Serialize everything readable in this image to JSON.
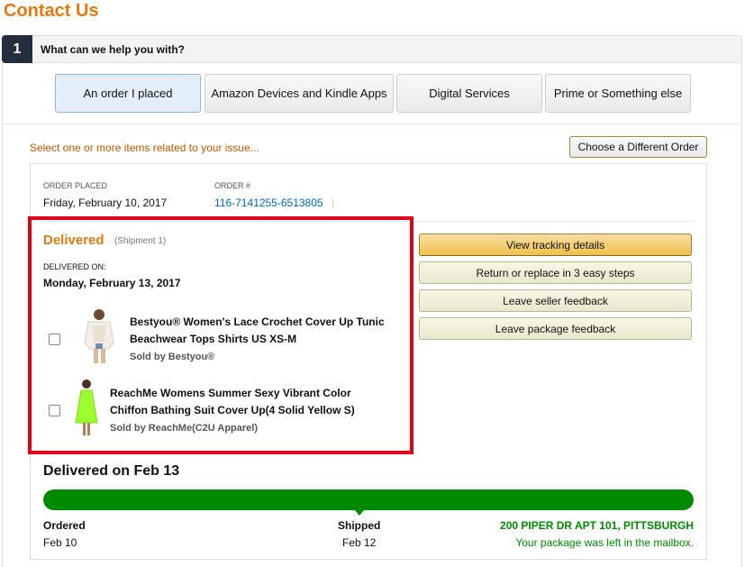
{
  "page_title": "Contact Us",
  "step": {
    "number": "1",
    "label": "What can we help you with?"
  },
  "categories": [
    {
      "label": "An order I placed",
      "selected": true
    },
    {
      "label": "Amazon Devices and Kindle Apps",
      "selected": false
    },
    {
      "label": "Digital Services",
      "selected": false
    },
    {
      "label": "Prime or Something else",
      "selected": false
    }
  ],
  "select_message": "Select one or more items related to your issue...",
  "choose_order_button": "Choose a Different Order",
  "order": {
    "placed_label": "ORDER PLACED",
    "placed_value": "Friday, February 10, 2017",
    "number_label": "ORDER #",
    "number_value": "116-7141255-6513805",
    "pipe": "|"
  },
  "shipment": {
    "status": "Delivered",
    "shipment_label": "(Shipment 1)",
    "delivered_on_label": "DELIVERED ON:",
    "delivered_on_value": "Monday, February 13, 2017",
    "items": [
      {
        "title_line1": "Bestyou® Women's Lace Crochet Cover Up Tunic",
        "title_line2": "Beachwear Tops Shirts US XS-M",
        "seller": "Sold by Bestyou®"
      },
      {
        "title_line1": "ReachMe Womens Summer Sexy Vibrant Color",
        "title_line2": "Chiffon Bathing Suit Cover Up(4 Solid Yellow S)",
        "seller": "Sold by ReachMe(C2U Apparel)"
      }
    ]
  },
  "actions": {
    "tracking": "View tracking details",
    "return": "Return or replace in 3 easy steps",
    "seller_feedback": "Leave seller feedback",
    "package_feedback": "Leave package feedback"
  },
  "tracking": {
    "headline": "Delivered on Feb 13",
    "progress_fraction": 1.0,
    "ordered_label": "Ordered",
    "ordered_date": "Feb 10",
    "shipped_label": "Shipped",
    "shipped_date": "Feb 12",
    "address": "200 PIPER DR APT 101, PITTSBURGH",
    "note": "Your package was left in the mailbox."
  },
  "colors": {
    "brand_orange": "#e47911",
    "link_blue": "#0066c0",
    "highlight_red": "#e0001a",
    "progress_green": "#008a00"
  }
}
